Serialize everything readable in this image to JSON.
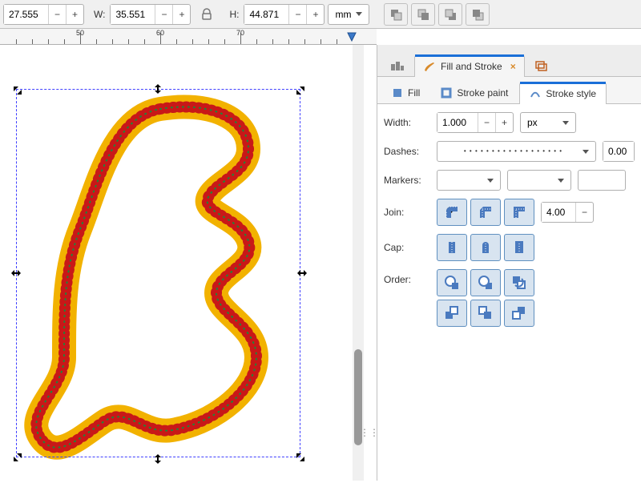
{
  "toolbar": {
    "x_value": "27.555",
    "w_label": "W:",
    "w_value": "35.551",
    "h_label": "H:",
    "h_value": "44.871",
    "unit": "mm"
  },
  "ruler": {
    "labels": [
      "50",
      "60",
      "70"
    ]
  },
  "dock": {
    "fill_stroke_label": "Fill and Stroke",
    "subtabs": {
      "fill": "Fill",
      "stroke_paint": "Stroke paint",
      "stroke_style": "Stroke style"
    }
  },
  "stroke": {
    "width_label": "Width:",
    "width_value": "1.000",
    "width_unit": "px",
    "dashes_label": "Dashes:",
    "dashes_offset": "0.00",
    "markers_label": "Markers:",
    "join_label": "Join:",
    "miter_value": "4.00",
    "cap_label": "Cap:",
    "order_label": "Order:"
  }
}
